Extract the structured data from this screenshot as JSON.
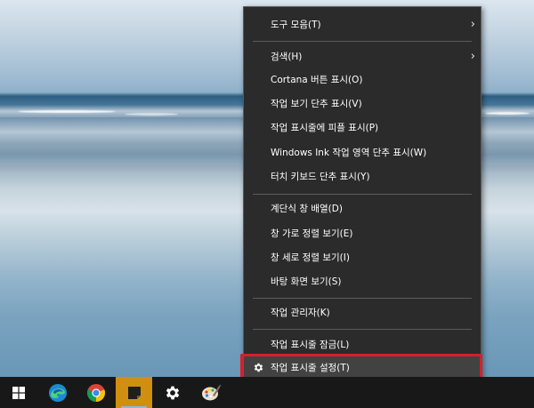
{
  "context_menu": {
    "items": [
      {
        "label": "도구 모음(T)",
        "submenu": true
      },
      {
        "label": "검색(H)",
        "submenu": true
      },
      {
        "label": "Cortana 버튼 표시(O)"
      },
      {
        "label": "작업 보기 단추 표시(V)"
      },
      {
        "label": "작업 표시줄에 피플 표시(P)"
      },
      {
        "label": "Windows Ink 작업 영역 단추 표시(W)"
      },
      {
        "label": "터치 키보드 단추 표시(Y)"
      },
      {
        "label": "계단식 창 배열(D)"
      },
      {
        "label": "창 가로 정렬 보기(E)"
      },
      {
        "label": "창 세로 정렬 보기(I)"
      },
      {
        "label": "바탕 화면 보기(S)"
      },
      {
        "label": "작업 관리자(K)"
      },
      {
        "label": "작업 표시줄 잠금(L)"
      },
      {
        "label": "작업 표시줄 설정(T)",
        "icon": "gear-icon",
        "highlighted": true
      }
    ],
    "submenu_glyph": "›"
  },
  "taskbar": {
    "buttons": [
      {
        "name": "windows-start-icon"
      },
      {
        "name": "edge-browser-icon"
      },
      {
        "name": "chrome-browser-icon"
      },
      {
        "name": "sticky-notes-icon"
      },
      {
        "name": "settings-gear-icon"
      },
      {
        "name": "paint-icon"
      }
    ]
  },
  "colors": {
    "menu_bg": "#2b2b2b",
    "highlight_border": "#d4202a",
    "taskbar_bg": "#181818"
  }
}
